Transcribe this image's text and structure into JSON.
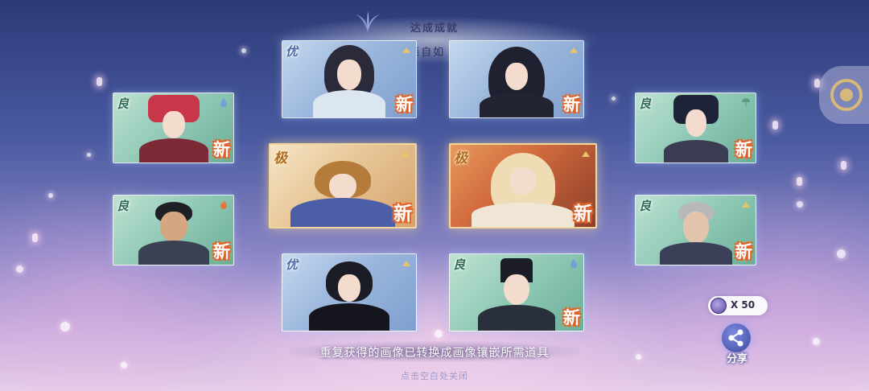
{
  "header": {
    "title": "达成成就",
    "subtitle": "挥洒自如 · 初"
  },
  "cards": [
    {
      "id": "c1",
      "rarity": "优",
      "rarity_class": "you",
      "new": "新",
      "theme": "blue",
      "size": "small",
      "type_icon": "mountain-icon"
    },
    {
      "id": "c2",
      "rarity": "",
      "rarity_class": "",
      "new": "新",
      "theme": "blue",
      "size": "small",
      "type_icon": "mountain-icon"
    },
    {
      "id": "c3",
      "rarity": "良",
      "rarity_class": "liang",
      "new": "新",
      "theme": "green",
      "size": "small",
      "type_icon": "water-drop-icon"
    },
    {
      "id": "c4",
      "rarity": "良",
      "rarity_class": "liang",
      "new": "新",
      "theme": "green",
      "size": "small",
      "type_icon": "umbrella-icon"
    },
    {
      "id": "c5",
      "rarity": "极",
      "rarity_class": "ji",
      "new": "新",
      "theme": "gold",
      "size": "large",
      "type_icon": "mountain-icon"
    },
    {
      "id": "c6",
      "rarity": "极",
      "rarity_class": "ji",
      "new": "新",
      "theme": "sunset",
      "size": "large",
      "type_icon": "mountain-icon"
    },
    {
      "id": "c7",
      "rarity": "良",
      "rarity_class": "liang",
      "new": "新",
      "theme": "green",
      "size": "small",
      "type_icon": "flame-icon"
    },
    {
      "id": "c8",
      "rarity": "良",
      "rarity_class": "liang",
      "new": "新",
      "theme": "green",
      "size": "small",
      "type_icon": "mountain-icon"
    },
    {
      "id": "c9",
      "rarity": "优",
      "rarity_class": "you",
      "new": "",
      "theme": "blue",
      "size": "small",
      "type_icon": "mountain-icon"
    },
    {
      "id": "c10",
      "rarity": "良",
      "rarity_class": "liang",
      "new": "新",
      "theme": "green",
      "size": "small",
      "type_icon": "water-drop-icon"
    }
  ],
  "footer": {
    "hint": "重复获得的画像已转换成画像镶嵌所需道具",
    "close_hint": "点击空白处关闭"
  },
  "currency": {
    "amount": "X 50",
    "icon": "currency-coin-icon"
  },
  "share": {
    "label": "分享",
    "icon": "share-icon"
  },
  "colors": {
    "new_badge_outline": "#e0632a",
    "large_card_frame": "#f1d79b",
    "bg_top": "#2c3a78",
    "bg_bottom": "#e6cde8"
  }
}
